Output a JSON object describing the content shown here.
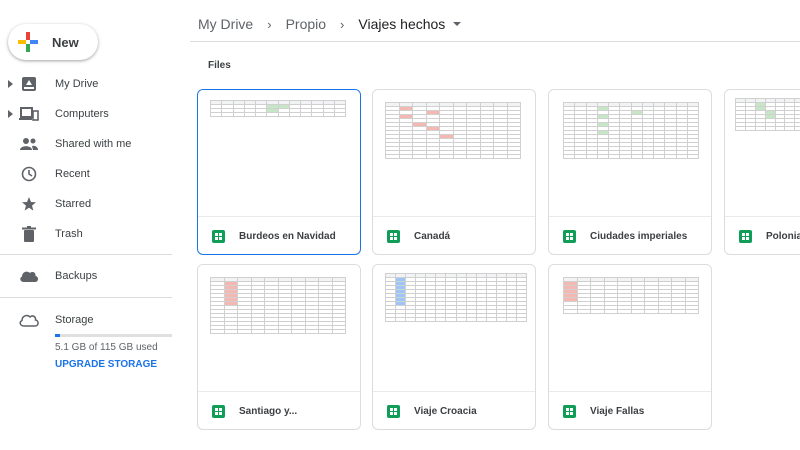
{
  "sidebar": {
    "new_label": "New",
    "items": [
      {
        "label": "My Drive",
        "icon": "drive-icon",
        "caret": true
      },
      {
        "label": "Computers",
        "icon": "computers-icon",
        "caret": true
      },
      {
        "label": "Shared with me",
        "icon": "shared-icon",
        "caret": false
      },
      {
        "label": "Recent",
        "icon": "clock-icon",
        "caret": false
      },
      {
        "label": "Starred",
        "icon": "star-icon",
        "caret": false
      },
      {
        "label": "Trash",
        "icon": "trash-icon",
        "caret": false
      },
      {
        "label": "Backups",
        "icon": "cloud-icon",
        "caret": false
      },
      {
        "label": "Storage",
        "icon": "cloud-outline-icon",
        "caret": false
      }
    ],
    "storage": {
      "used_text": "5.1 GB of 115 GB used",
      "used_fraction": 0.044,
      "upgrade_label": "UPGRADE STORAGE"
    }
  },
  "header": {
    "breadcrumb": [
      "My Drive",
      "Propio",
      "Viajes hechos"
    ]
  },
  "section": {
    "label": "Files"
  },
  "files": [
    {
      "name": "Burdeos en Navidad",
      "selected": true
    },
    {
      "name": "Canadá",
      "selected": false
    },
    {
      "name": "Ciudades imperiales",
      "selected": false
    },
    {
      "name": "Polonia",
      "selected": false
    },
    {
      "name": "Santiago y...",
      "selected": false
    },
    {
      "name": "Viaje Croacia",
      "selected": false
    },
    {
      "name": "Viaje Fallas",
      "selected": false
    }
  ],
  "colors": {
    "accent": "#1a73e8",
    "sheets_green": "#0f9d58",
    "google_blue": "#4285f4",
    "google_red": "#ea4335",
    "google_yellow": "#fbbc04",
    "google_green": "#34a853"
  }
}
